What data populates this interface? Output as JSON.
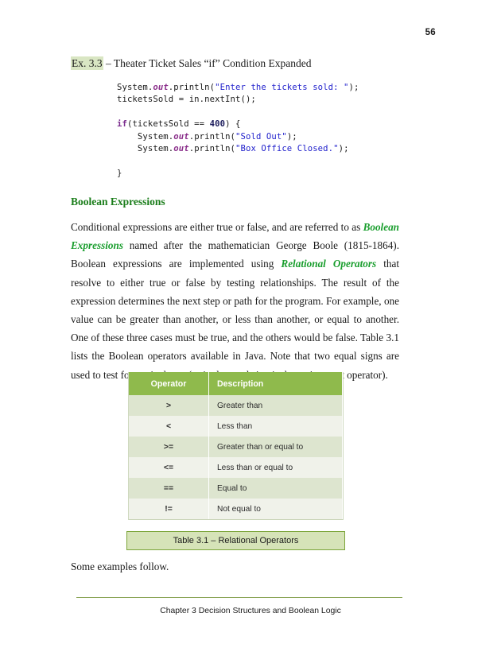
{
  "page": {
    "number": "56"
  },
  "example": {
    "tag": "Ex. 3.3",
    "title": " – Theater Ticket Sales “if” Condition Expanded"
  },
  "code": {
    "lines": [
      "System.out.println(\"Enter the tickets sold: \");",
      "ticketsSold = in.nextInt();",
      "",
      "if(ticketsSold == 400) {",
      "    System.out.println(\"Sold Out\");",
      "    System.out.println(\"Box Office Closed.\");",
      "",
      "}"
    ],
    "tokens": {
      "system": "System",
      "field_out": "out",
      "println": ".println(",
      "str_enter": "\"Enter the tickets sold: \"",
      "end_paren": ");",
      "tickets_assign": "ticketsSold = in.nextInt();",
      "kw_if": "if",
      "cond_open": "(ticketsSold == ",
      "num_400": "400",
      "cond_close": ") {",
      "str_sold_out": "\"Sold Out\"",
      "str_box_office": "\"Box Office Closed.\"",
      "brace_close": "}",
      "indent4": "    "
    },
    "colors": {
      "keyword": "#7b2d8e",
      "field": "#8b2f8b",
      "string": "#2222cc",
      "number": "#1c1c5c",
      "plain": "#1a1a1a"
    }
  },
  "section": {
    "heading": "Boolean Expressions",
    "heading_color": "#1a7d1a"
  },
  "paragraph": {
    "part1": "Conditional expressions are either true or false, and are referred to as ",
    "term1": "Boolean Expressions",
    "part2": " named after the mathematician George Boole (1815-1864).  Boolean expressions are implemented using ",
    "term2": "Relational Operators",
    "part3": " that resolve to either true or false by testing relationships.  The result of the expression determines the next step or path for the program.  For example, one value can be greater than another, or less than another, or equal to another.  One of these three cases must be true, and the others would be false.  Table 3.1 lists the Boolean operators available in Java.  Note that two equal signs are used to test for equivalence (a single equal sign is the assignment operator).",
    "term_color": "#1a9e2e"
  },
  "table": {
    "headers": [
      "Operator",
      "Description"
    ],
    "header_bg": "#8fba4c",
    "row_odd_bg": "#dde5cf",
    "row_even_bg": "#f0f2ea",
    "rows": [
      {
        "operator": ">",
        "description": "Greater than"
      },
      {
        "operator": "<",
        "description": "Less than"
      },
      {
        "operator": ">=",
        "description": "Greater than or equal to"
      },
      {
        "operator": "<=",
        "description": "Less than or equal to"
      },
      {
        "operator": "==",
        "description": "Equal to"
      },
      {
        "operator": "!=",
        "description": "Not equal to"
      }
    ],
    "caption": "Table 3.1 – Relational Operators",
    "caption_bg": "#d6e3b8",
    "caption_border": "#7ca53a"
  },
  "closing": {
    "text": "Some examples follow."
  },
  "footer": {
    "text": "Chapter 3 Decision Structures and Boolean Logic",
    "rule_color": "#8aa557"
  }
}
